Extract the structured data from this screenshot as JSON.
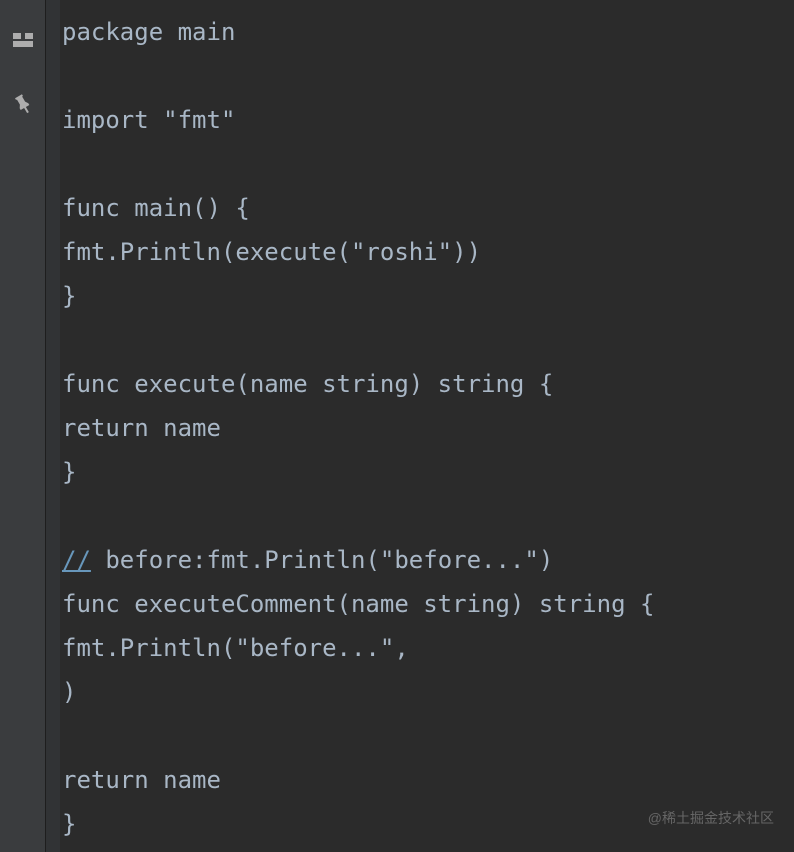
{
  "sidebar": {
    "icons": [
      "structure-icon",
      "pin-icon"
    ]
  },
  "code": {
    "lines": [
      {
        "text": "package main",
        "class": ""
      },
      {
        "text": "",
        "class": ""
      },
      {
        "text": "import \"fmt\"",
        "class": ""
      },
      {
        "text": "",
        "class": ""
      },
      {
        "text": "func main() {",
        "class": ""
      },
      {
        "text": "fmt.Println(execute(\"roshi\"))",
        "class": ""
      },
      {
        "text": "}",
        "class": ""
      },
      {
        "text": "",
        "class": ""
      },
      {
        "text": "func execute(name string) string {",
        "class": ""
      },
      {
        "text": "return name",
        "class": ""
      },
      {
        "text": "}",
        "class": ""
      },
      {
        "text": "",
        "class": ""
      },
      {
        "prefix": "//",
        "prefixClass": "comment-link",
        "rest": " before:fmt.Println(\"before...\")"
      },
      {
        "text": "func executeComment(name string) string {",
        "class": ""
      },
      {
        "text": "fmt.Println(\"before...\",",
        "class": ""
      },
      {
        "text": ")",
        "class": ""
      },
      {
        "text": "",
        "class": ""
      },
      {
        "text": "return name",
        "class": ""
      },
      {
        "text": "}",
        "class": ""
      }
    ]
  },
  "watermark": "@稀土掘金技术社区"
}
